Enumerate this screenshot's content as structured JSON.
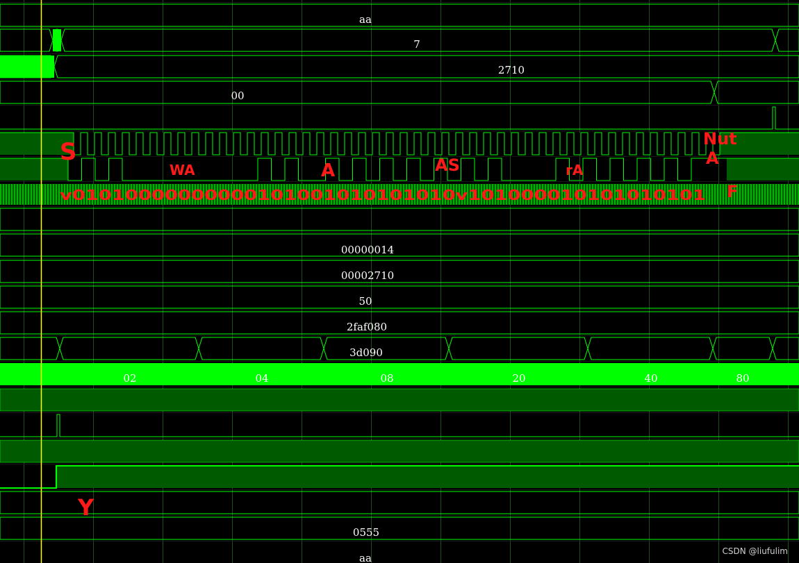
{
  "colors": {
    "background": "#000000",
    "trace": "#00ff00",
    "trace_dark": "#005a00",
    "grid": "#3fb83f",
    "cursor": "#ffff00",
    "annotation": "#ff1a1a",
    "value_text": "#ffffff"
  },
  "signals": [
    {
      "kind": "bus",
      "segments": [
        {
          "value": "aa"
        }
      ]
    },
    {
      "kind": "bus",
      "segments": [
        {
          "value": ""
        },
        {
          "value": "7"
        },
        {
          "value": ""
        }
      ]
    },
    {
      "kind": "bus",
      "segments": [
        {
          "value": ""
        },
        {
          "value": "2710"
        }
      ]
    },
    {
      "kind": "bus",
      "segments": [
        {
          "value": "00"
        },
        {
          "value": ""
        }
      ]
    },
    {
      "kind": "pulse",
      "note": "short high pulse near end"
    },
    {
      "kind": "clock",
      "note": "scl toggling"
    },
    {
      "kind": "data",
      "note": "sda serial bits"
    },
    {
      "kind": "dense-clock",
      "note": "system clock"
    },
    {
      "kind": "bus",
      "segments": [
        {
          "value": "00000014"
        }
      ]
    },
    {
      "kind": "bus",
      "segments": [
        {
          "value": "00002710"
        }
      ]
    },
    {
      "kind": "bus",
      "segments": [
        {
          "value": "50"
        }
      ]
    },
    {
      "kind": "bus",
      "segments": [
        {
          "value": "2faf080"
        }
      ]
    },
    {
      "kind": "bus",
      "segments": [
        {
          "value": "3d090"
        }
      ]
    },
    {
      "kind": "bus",
      "segments": [
        {
          "value": ""
        },
        {
          "value": "02"
        },
        {
          "value": "04"
        },
        {
          "value": "08"
        },
        {
          "value": "20"
        },
        {
          "value": "40"
        },
        {
          "value": "80"
        },
        {
          "value": ""
        }
      ]
    },
    {
      "kind": "solid-high"
    },
    {
      "kind": "solid-dark"
    },
    {
      "kind": "pulse"
    },
    {
      "kind": "solid-dark"
    },
    {
      "kind": "step-high"
    },
    {
      "kind": "bus",
      "segments": [
        {
          "value": "0555"
        }
      ]
    },
    {
      "kind": "bus",
      "segments": [
        {
          "value": "aa"
        }
      ]
    }
  ],
  "annotations": {
    "start": "S",
    "write_ack": "WA",
    "ack1": "A",
    "restart": "AS",
    "read_ack": "rA",
    "nack": "Nut",
    "ack_final": "A",
    "finish": "F",
    "ready": "Y",
    "bits": "v01010000000000101001010101010v101000010101010101"
  },
  "watermark": "CSDN @liufulim"
}
